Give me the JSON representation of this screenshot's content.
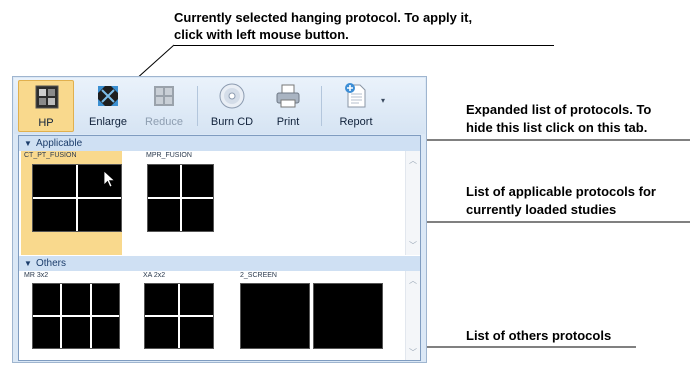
{
  "annotations": {
    "selected_protocol_line1": "Currently selected hanging protocol. To apply it,",
    "selected_protocol_line2": "click with left mouse button.",
    "expanded_line1": "Expanded list of protocols. To",
    "expanded_line2": "hide this list click on this tab.",
    "applicable_line1": "List of applicable protocols for",
    "applicable_line2": "currently loaded studies",
    "others": "List of others protocols"
  },
  "toolbar": {
    "hp_label": "HP",
    "enlarge_label": "Enlarge",
    "reduce_label": "Reduce",
    "burncd_label": "Burn CD",
    "print_label": "Print",
    "report_label": "Report"
  },
  "sections": {
    "applicable_title": "Applicable",
    "others_title": "Others"
  },
  "applicable_protocols": [
    "CT_PT_FUSION",
    "MPR_FUSION"
  ],
  "other_protocols": [
    "MR 3x2",
    "XA 2x2",
    "2_SCREEN"
  ],
  "colors": {
    "selected_highlight": "#f9d98d",
    "panel_header": "#cfe0f3",
    "window_bg": "#dbe8f6"
  }
}
